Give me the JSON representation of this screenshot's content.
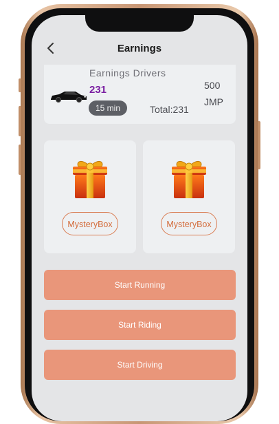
{
  "header": {
    "title": "Earnings"
  },
  "card": {
    "name": "Earnings Drivers",
    "count": "231",
    "timer": "15 min",
    "total": "Total:231",
    "amount": "500",
    "unit": "JMP"
  },
  "boxes": [
    {
      "label": "MysteryBox"
    },
    {
      "label": "MysteryBox"
    }
  ],
  "actions": [
    {
      "label": "Start Running"
    },
    {
      "label": "Start Riding"
    },
    {
      "label": "Start Driving"
    }
  ],
  "colors": {
    "accent": "#e9967a",
    "outline": "#d97c52",
    "count": "#7b1fa2"
  },
  "icons": [
    "back-arrow-icon",
    "car-icon",
    "gift-icon"
  ]
}
